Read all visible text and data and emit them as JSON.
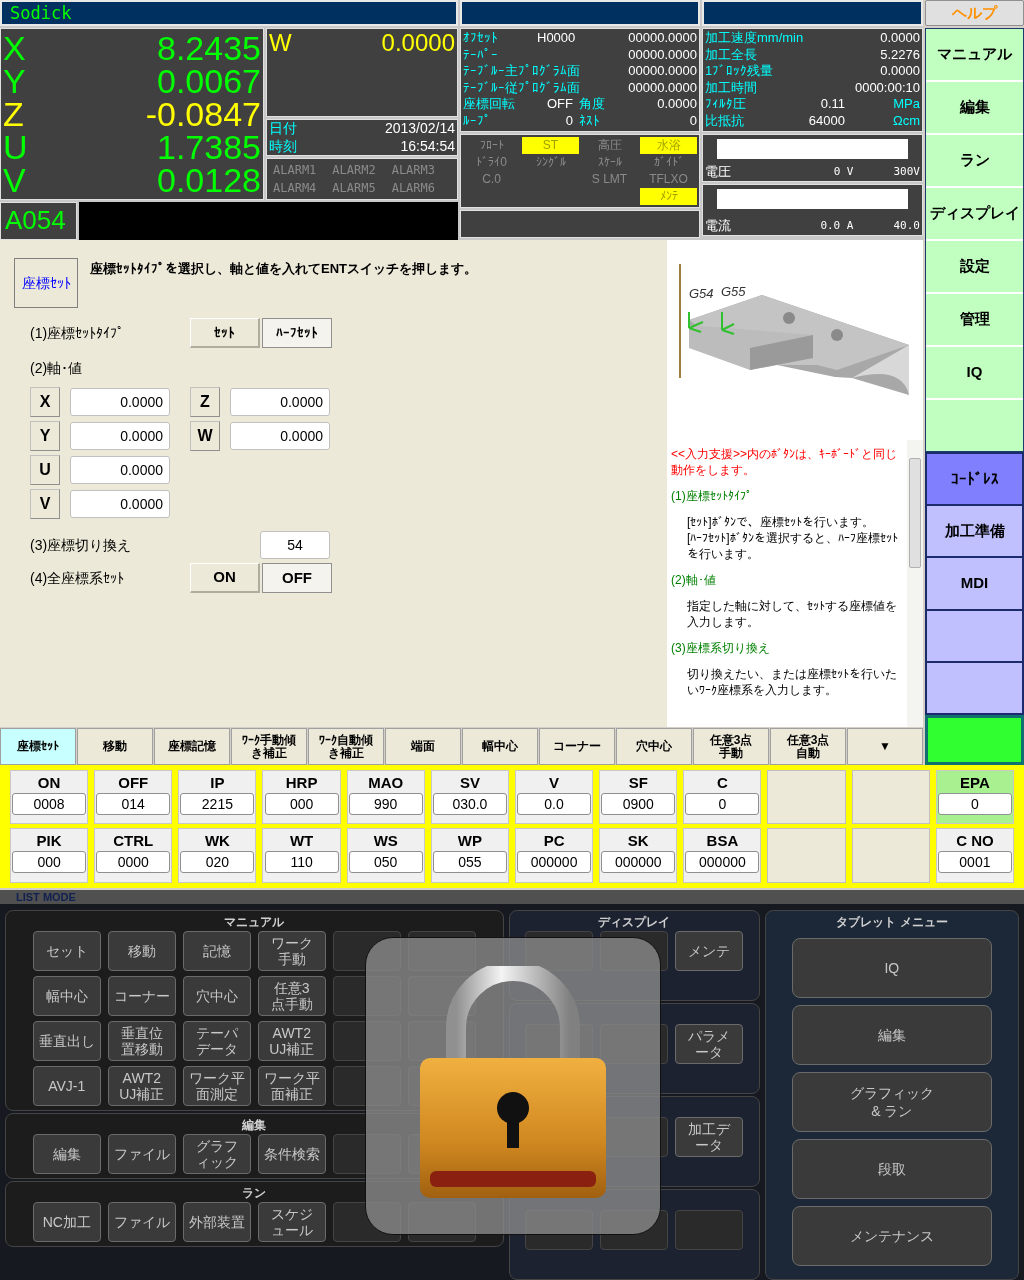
{
  "title_bar": {
    "title": "Sodick"
  },
  "help_button": {
    "label": "ヘルプ"
  },
  "axes": [
    {
      "axis": "X",
      "value": "8.2435",
      "color": "#00ff00"
    },
    {
      "axis": "Y",
      "value": "0.0067",
      "color": "#00ff00"
    },
    {
      "axis": "Z",
      "value": "-0.0847",
      "color": "#ffff00"
    },
    {
      "axis": "U",
      "value": "1.7385",
      "color": "#00ff00"
    },
    {
      "axis": "V",
      "value": "0.0128",
      "color": "#00ff00"
    }
  ],
  "w_axis": {
    "axis": "W",
    "value": "0.0000",
    "color": "#ffff00"
  },
  "clock": {
    "date_label": "日付",
    "date": "2013/02/14",
    "time_label": "時刻",
    "time": "16:54:54"
  },
  "alarms": [
    "ALARM1",
    "ALARM2",
    "ALARM3",
    "ALARM4",
    "ALARM5",
    "ALARM6"
  ],
  "program_code": "A054",
  "offsets": [
    {
      "label": "ｵﾌｾｯﾄ",
      "mid": "H0000",
      "value": "00000.0000"
    },
    {
      "label": "ﾃｰﾊﾟｰ",
      "value": "00000.0000"
    },
    {
      "label": "ﾃｰﾌﾞﾙｰ主ﾌﾟﾛｸﾞﾗﾑ面",
      "value": "00000.0000"
    },
    {
      "label": "ﾃｰﾌﾞﾙｰ従ﾌﾟﾛｸﾞﾗﾑ面",
      "value": "00000.0000"
    },
    {
      "label": "座標回転",
      "mid": "OFF",
      "label_2": "角度",
      "value": "0.0000"
    },
    {
      "label": "ﾙｰﾌﾟ",
      "mid": "0",
      "label_2": "ﾈｽﾄ",
      "value": "0"
    }
  ],
  "status_flags": [
    [
      {
        "kind": "flag",
        "label": "ﾌﾛｰﾄ",
        "on": false
      },
      {
        "kind": "flag",
        "label": "ST",
        "on": true
      },
      {
        "kind": "flag",
        "label": "高圧",
        "on": false
      },
      {
        "kind": "flag",
        "label": "水浴",
        "on": true
      }
    ],
    [
      {
        "kind": "flag",
        "label": "ﾄﾞﾗｲ0",
        "on": false
      },
      {
        "kind": "flag",
        "label": "ｼﾝｸﾞﾙ",
        "on": false
      },
      {
        "kind": "flag",
        "label": "ｽｹｰﾙ",
        "on": false
      },
      {
        "kind": "flag",
        "label": "ｶﾞｲﾄﾞ",
        "on": false
      }
    ],
    [
      {
        "kind": "flag",
        "label": "C.0",
        "on": false
      },
      {
        "kind": "empty"
      },
      {
        "kind": "flag",
        "label": "S LMT",
        "on": false
      },
      {
        "kind": "flag",
        "label": "TFLXO",
        "on": false
      }
    ],
    [
      {
        "kind": "empty"
      },
      {
        "kind": "empty"
      },
      {
        "kind": "empty"
      },
      {
        "kind": "flag",
        "label": "ﾒﾝﾃ",
        "on": true
      }
    ]
  ],
  "machining": [
    {
      "label": "加工速度mm/min",
      "value": "0.0000"
    },
    {
      "label": "加工全長",
      "value": "5.2276"
    },
    {
      "label": "1ﾌﾞﾛｯｸ残量",
      "value": "0.0000"
    },
    {
      "label": "加工時間",
      "value": "0000:00:10"
    },
    {
      "label": "ﾌｨﾙﾀ圧",
      "mid": "0.11",
      "unit": "MPa"
    },
    {
      "label": "比抵抗",
      "mid": "64000",
      "unit": "Ωcm"
    }
  ],
  "meters": [
    {
      "label": "電圧",
      "reading": "0 V",
      "max": "300V",
      "level": 0
    },
    {
      "label": "電流",
      "reading": "0.0 A",
      "max": "40.0",
      "level": 0
    }
  ],
  "side_menu": [
    {
      "label": "マニュアル",
      "selected": false
    },
    {
      "label": "編集",
      "selected": false
    },
    {
      "label": "ラン",
      "selected": false
    },
    {
      "label": "ディスプレイ",
      "selected": false
    },
    {
      "label": "設定",
      "selected": false
    },
    {
      "label": "管理",
      "selected": false
    },
    {
      "label": "IQ",
      "selected": false
    },
    {
      "selected": false
    }
  ],
  "side_menu_2": [
    {
      "label": "ｺｰﾄﾞﾚｽ",
      "selected": true
    },
    {
      "label": "加工準備",
      "selected": false
    },
    {
      "label": "MDI",
      "selected": false
    },
    {
      "selected": false
    },
    {
      "selected": false
    }
  ],
  "form": {
    "mode_button": "座標ｾｯﾄ",
    "instruction": "座標ｾｯﾄﾀｲﾌﾟを選択し、軸と値を入れてENTスイッチを押します。",
    "set_type": {
      "label": "(1)座標ｾｯﾄﾀｲﾌﾟ",
      "options": [
        {
          "label": "ｾｯﾄ",
          "selected": true
        },
        {
          "label": "ﾊｰﾌｾｯﾄ",
          "selected": false
        }
      ]
    },
    "axis_values": {
      "label": "(2)軸･値",
      "columns": [
        [
          {
            "axis": "X",
            "value": "0.0000"
          },
          {
            "axis": "Y",
            "value": "0.0000"
          },
          {
            "axis": "U",
            "value": "0.0000"
          },
          {
            "axis": "V",
            "value": "0.0000"
          }
        ],
        [
          {
            "axis": "Z",
            "value": "0.0000"
          },
          {
            "axis": "W",
            "value": "0.0000"
          }
        ]
      ]
    },
    "switch_coord": {
      "label": "(3)座標切り換え",
      "value": "54"
    },
    "all_coord_set": {
      "label": "(4)全座標系ｾｯﾄ",
      "options": [
        {
          "label": "ON",
          "selected": true
        },
        {
          "label": "OFF",
          "selected": false
        }
      ]
    }
  },
  "figure": {
    "labels": [
      "G54",
      "G55"
    ]
  },
  "help": {
    "intro": "<<入力支援>>内のﾎﾞﾀﾝは、ｷｰﾎﾞｰﾄﾞと同じ動作をします。",
    "sections": [
      {
        "heading": "(1)座標ｾｯﾄﾀｲﾌﾟ",
        "body": "[ｾｯﾄ]ﾎﾞﾀﾝで、座標ｾｯﾄを行います。\n[ﾊｰﾌｾｯﾄ]ﾎﾞﾀﾝを選択すると、ﾊｰﾌ座標ｾｯﾄを行います。"
      },
      {
        "heading": "(2)軸･値",
        "body": "指定した軸に対して、ｾｯﾄする座標値を入力します。"
      },
      {
        "heading": "(3)座標系切り換え",
        "body": "切り換えたい、または座標ｾｯﾄを行いたいﾜｰｸ座標系を入力します。"
      }
    ]
  },
  "tabs": [
    {
      "label": "座標ｾｯﾄ",
      "selected": true
    },
    {
      "label": "移動",
      "selected": false
    },
    {
      "label": "座標記憶",
      "selected": false
    },
    {
      "label": "ﾜｰｸ手動傾き補正",
      "selected": false
    },
    {
      "label": "ﾜｰｸ自動傾き補正",
      "selected": false
    },
    {
      "label": "端面",
      "selected": false
    },
    {
      "label": "幅中心",
      "selected": false
    },
    {
      "label": "コーナー",
      "selected": false
    },
    {
      "label": "穴中心",
      "selected": false
    },
    {
      "label": "任意3点手動",
      "selected": false
    },
    {
      "label": "任意3点自動",
      "selected": false
    },
    {
      "label": "▼",
      "selected": false
    }
  ],
  "params": [
    {
      "kind": "param",
      "name": "ON",
      "value": "0008",
      "highlighted": false
    },
    {
      "kind": "param",
      "name": "OFF",
      "value": "014",
      "highlighted": false
    },
    {
      "kind": "param",
      "name": "IP",
      "value": "2215",
      "highlighted": false
    },
    {
      "kind": "param",
      "name": "HRP",
      "value": "000",
      "highlighted": false
    },
    {
      "kind": "param",
      "name": "MAO",
      "value": "990",
      "highlighted": false
    },
    {
      "kind": "param",
      "name": "SV",
      "value": "030.0",
      "highlighted": false
    },
    {
      "kind": "param",
      "name": "V",
      "value": "0.0",
      "highlighted": false
    },
    {
      "kind": "param",
      "name": "SF",
      "value": "0900",
      "highlighted": false
    },
    {
      "kind": "param",
      "name": "C",
      "value": "0",
      "highlighted": false
    },
    {
      "kind": "empty"
    },
    {
      "kind": "empty"
    },
    {
      "kind": "param",
      "name": "EPA",
      "value": "0",
      "highlighted": true
    },
    {
      "kind": "param",
      "name": "PIK",
      "value": "000",
      "highlighted": false
    },
    {
      "kind": "param",
      "name": "CTRL",
      "value": "0000",
      "highlighted": false
    },
    {
      "kind": "param",
      "name": "WK",
      "value": "020",
      "highlighted": false
    },
    {
      "kind": "param",
      "name": "WT",
      "value": "110",
      "highlighted": false
    },
    {
      "kind": "param",
      "name": "WS",
      "value": "050",
      "highlighted": false
    },
    {
      "kind": "param",
      "name": "WP",
      "value": "055",
      "highlighted": false
    },
    {
      "kind": "param",
      "name": "PC",
      "value": "000000",
      "highlighted": false
    },
    {
      "kind": "param",
      "name": "SK",
      "value": "000000",
      "highlighted": false
    },
    {
      "kind": "param",
      "name": "BSA",
      "value": "000000",
      "highlighted": false
    },
    {
      "kind": "empty"
    },
    {
      "kind": "empty"
    },
    {
      "kind": "param",
      "name": "C NO",
      "value": "0001",
      "highlighted": false
    }
  ],
  "list_mode": {
    "title": "LIST MODE",
    "left_sections": [
      {
        "title": "マニュアル",
        "buttons": [
          {
            "kind": "button",
            "label": "セット"
          },
          {
            "kind": "button",
            "label": "移動"
          },
          {
            "kind": "button",
            "label": "記憶"
          },
          {
            "kind": "button",
            "label": "ワーク手動"
          },
          {
            "kind": "blank"
          },
          {
            "kind": "blank"
          },
          {
            "kind": "button",
            "label": "幅中心"
          },
          {
            "kind": "button",
            "label": "コーナー"
          },
          {
            "kind": "button",
            "label": "穴中心"
          },
          {
            "kind": "button",
            "label": "任意3点手動"
          },
          {
            "kind": "blank"
          },
          {
            "kind": "blank"
          },
          {
            "kind": "button",
            "label": "垂直出し"
          },
          {
            "kind": "button",
            "label": "垂直位置移動"
          },
          {
            "kind": "button",
            "label": "テーパデータ"
          },
          {
            "kind": "button",
            "label": "AWT2 UJ補正"
          },
          {
            "kind": "blank"
          },
          {
            "kind": "blank"
          },
          {
            "kind": "button",
            "label": "AVJ-1"
          },
          {
            "kind": "button",
            "label": "AWT2 UJ補正"
          },
          {
            "kind": "button",
            "label": "ワーク平面測定"
          },
          {
            "kind": "button",
            "label": "ワーク平面補正"
          },
          {
            "kind": "blank"
          },
          {
            "kind": "blank"
          }
        ]
      },
      {
        "title": "編集",
        "buttons": [
          {
            "kind": "button",
            "label": "編集"
          },
          {
            "kind": "button",
            "label": "ファイル"
          },
          {
            "kind": "button",
            "label": "グラフィック"
          },
          {
            "kind": "button",
            "label": "条件検索"
          },
          {
            "kind": "blank"
          },
          {
            "kind": "blank"
          }
        ]
      },
      {
        "title": "ラン",
        "buttons": [
          {
            "kind": "button",
            "label": "NC加工"
          },
          {
            "kind": "button",
            "label": "ファイル"
          },
          {
            "kind": "button",
            "label": "外部装置"
          },
          {
            "kind": "button",
            "label": "スケジュール"
          },
          {
            "kind": "blank"
          },
          {
            "kind": "blank"
          }
        ]
      }
    ],
    "display_section": {
      "title": "ディスプレイ",
      "groups": [
        [
          {
            "kind": "blank"
          },
          {
            "kind": "blank"
          },
          {
            "kind": "button",
            "label": "メンテ"
          }
        ],
        [
          {
            "kind": "blank"
          },
          {
            "kind": "blank"
          },
          {
            "kind": "button",
            "label": "パラメータ"
          }
        ],
        [
          {
            "kind": "blank"
          },
          {
            "kind": "blank"
          },
          {
            "kind": "button",
            "label": "加工データ"
          }
        ],
        [
          {
            "kind": "blank"
          },
          {
            "kind": "blank"
          },
          {
            "kind": "blank"
          }
        ]
      ]
    },
    "tablet_menu": {
      "title": "タブレット メニュー",
      "buttons": [
        "IQ",
        "編集",
        "グラフィック & ラン",
        "段取",
        "メンテナンス"
      ]
    },
    "locked": true
  }
}
